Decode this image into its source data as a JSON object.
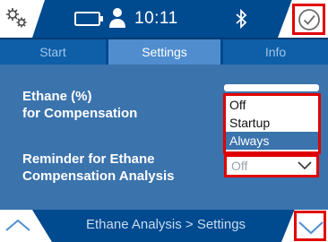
{
  "status_bar": {
    "time": "10:11",
    "icons": [
      "gears-icon",
      "battery-icon",
      "user-icon",
      "bluetooth-icon",
      "check-circle-icon"
    ]
  },
  "tabs": [
    {
      "label": "Start",
      "active": false
    },
    {
      "label": "Settings",
      "active": true
    },
    {
      "label": "Info",
      "active": false
    }
  ],
  "settings": {
    "ethane_label_line1": "Ethane (%)",
    "ethane_label_line2": "for Compensation",
    "reminder_label_line1": "Reminder for Ethane",
    "reminder_label_line2": "Compensation Analysis",
    "dropdown_options": [
      "Off",
      "Startup",
      "Always"
    ],
    "dropdown_highlighted": "Always",
    "reminder_value": "Off"
  },
  "bottom_bar": {
    "breadcrumb": "Ethane Analysis > Settings"
  },
  "colors": {
    "highlight": "#e10000",
    "panel": "#3b73ad",
    "bar": "#004a8f"
  }
}
